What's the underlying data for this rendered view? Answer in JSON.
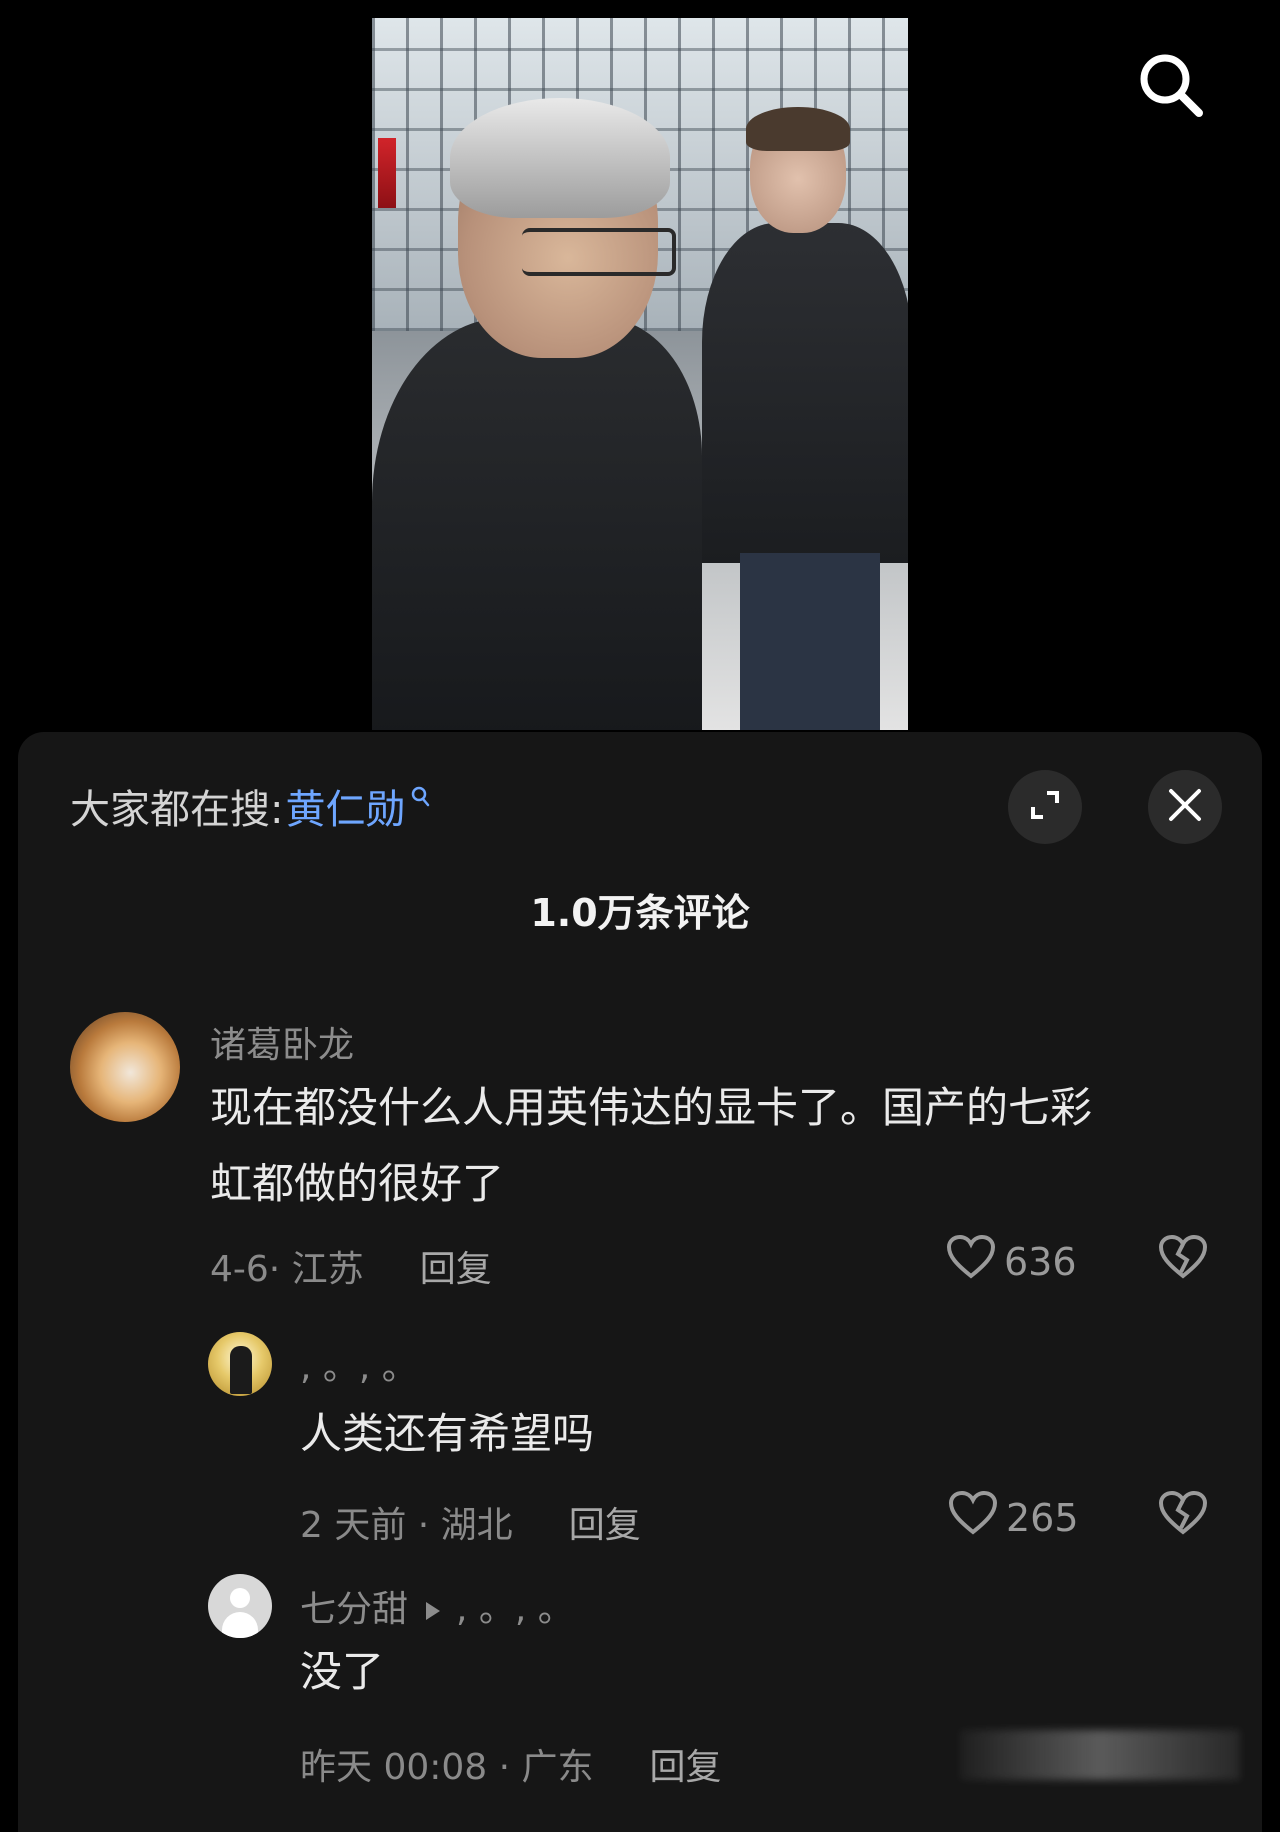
{
  "search_bar": {
    "prefix": "大家都在搜:",
    "keyword": "黄仁勋"
  },
  "comments_header": {
    "count_label": "1.0万条评论"
  },
  "comments": [
    {
      "username": "诸葛卧龙",
      "text_line1": "现在都没什么人用英伟达的显卡了。国产的七彩",
      "text_line2": "虹都做的很好了",
      "time_location": "4-6· 江苏",
      "reply_label": "回复",
      "likes": "636"
    }
  ],
  "replies": [
    {
      "username": ", 。, 。",
      "text": "人类还有希望吗",
      "time_location": "2 天前 · 湖北",
      "reply_label": "回复",
      "likes": "265"
    },
    {
      "username": "七分甜",
      "reply_to": ", 。, 。",
      "text": "没了",
      "time_location": "昨天 00:08 · 广东",
      "reply_label": "回复"
    }
  ],
  "icons": {
    "search": "search-icon",
    "expand": "expand-icon",
    "close": "close-icon",
    "like": "heart-icon",
    "dislike": "broken-heart-icon"
  },
  "colors": {
    "background": "#000000",
    "sheet": "#161616",
    "keyword": "#6ea6ff",
    "text_primary": "#eaeaea",
    "text_secondary": "#8a8a8a"
  }
}
